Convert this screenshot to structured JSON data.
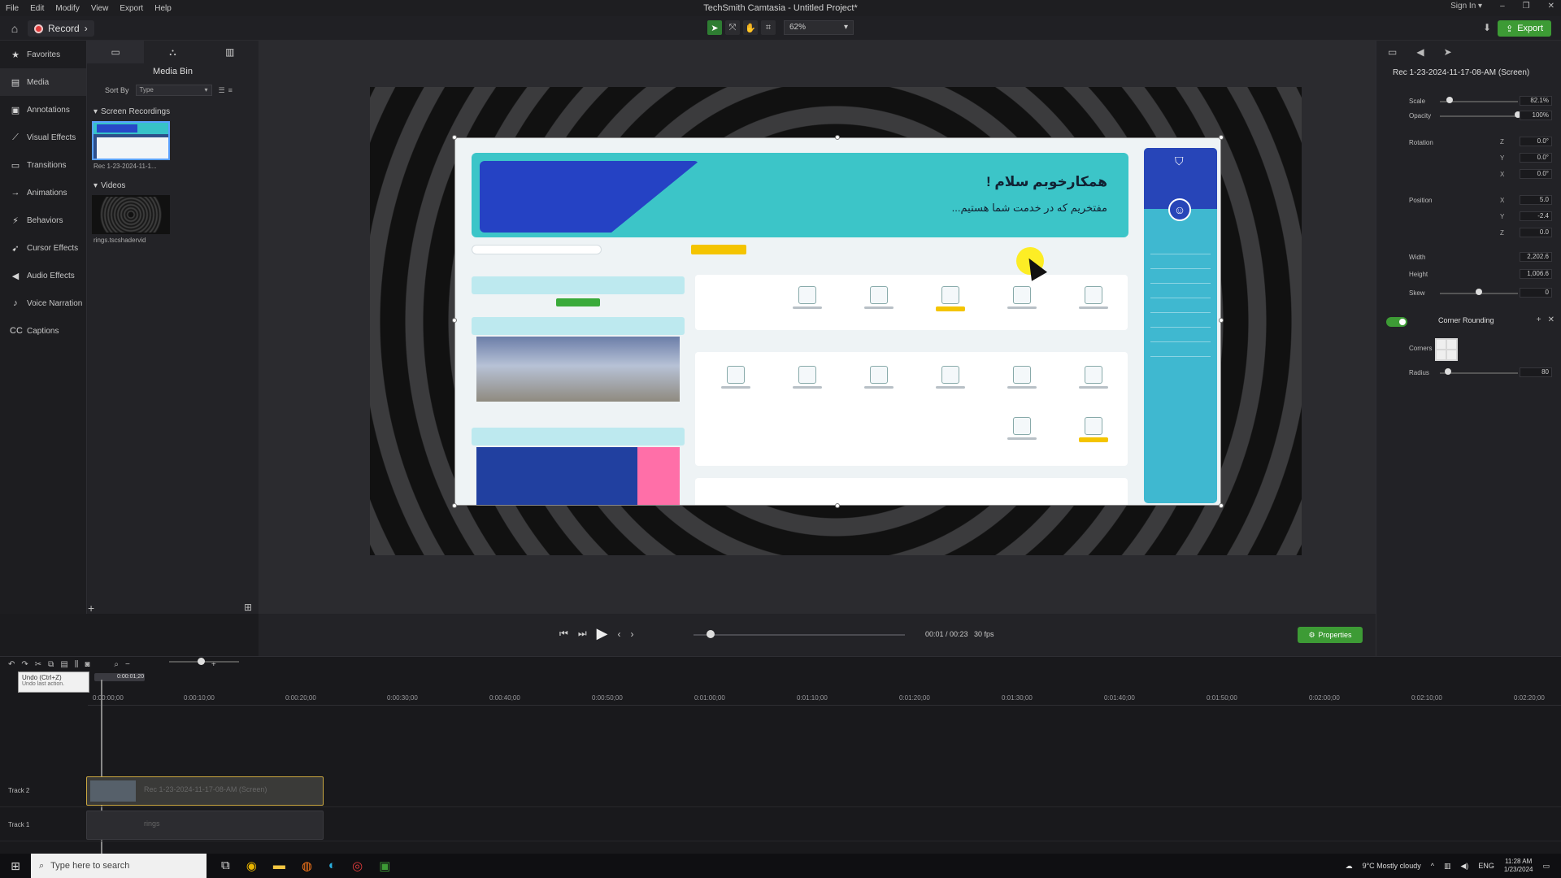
{
  "window": {
    "title": "TechSmith Camtasia - Untitled Project*",
    "menu": [
      "File",
      "Edit",
      "Modify",
      "View",
      "Export",
      "Help"
    ],
    "sign_in": "Sign In ▾"
  },
  "toolbar": {
    "record_label": "Record",
    "zoom_value": "62%",
    "export_label": "Export"
  },
  "sidebar": {
    "items": [
      {
        "label": "Favorites",
        "icon": "star-icon"
      },
      {
        "label": "Media",
        "icon": "film-icon"
      },
      {
        "label": "Annotations",
        "icon": "annotation-icon"
      },
      {
        "label": "Visual Effects",
        "icon": "wand-icon"
      },
      {
        "label": "Transitions",
        "icon": "transition-icon"
      },
      {
        "label": "Animations",
        "icon": "arrow-icon"
      },
      {
        "label": "Behaviors",
        "icon": "behavior-icon"
      },
      {
        "label": "Cursor Effects",
        "icon": "cursor-icon"
      },
      {
        "label": "Audio Effects",
        "icon": "speaker-icon"
      },
      {
        "label": "Voice Narration",
        "icon": "mic-icon"
      },
      {
        "label": "Captions",
        "icon": "cc-icon"
      }
    ]
  },
  "media_bin": {
    "title": "Media Bin",
    "sort_by_label": "Sort By",
    "sort_value": "Type",
    "section_recordings": "Screen Recordings",
    "recording_name": "Rec 1-23-2024-11-1...",
    "section_videos": "Videos",
    "video_name": "rings.tscshadervid"
  },
  "canvas": {
    "banner_title": "همکارخوبم سلام !",
    "banner_sub": "مفتخریم که در خدمت شما هستیم..."
  },
  "playback": {
    "time": "00:01 / 00:23",
    "fps": "30 fps",
    "properties_label": "Properties"
  },
  "properties": {
    "clip_name": "Rec 1-23-2024-11-17-08-AM (Screen)",
    "scale_label": "Scale",
    "scale_value": "82.1%",
    "scale_level": 0.12,
    "opacity_label": "Opacity",
    "opacity_value": "100%",
    "opacity_level": 1.0,
    "rotation_label": "Rotation",
    "rot_z": "0.0°",
    "rot_y": "0.0°",
    "rot_x": "0.0°",
    "position_label": "Position",
    "pos_x": "5.0",
    "pos_y": "-2.4",
    "pos_z": "0.0",
    "width_label": "Width",
    "width_value": "2,202.6",
    "height_label": "Height",
    "height_value": "1,006.6",
    "skew_label": "Skew",
    "skew_value": "0",
    "skew_level": 0.5,
    "corner_rounding_label": "Corner Rounding",
    "corners_label": "Corners",
    "radius_label": "Radius",
    "radius_value": "80",
    "radius_level": 0.1
  },
  "timeline": {
    "tooltip_title": "Undo (Ctrl+Z)",
    "tooltip_desc": "Undo last action.",
    "playhead_time": "0:00:01;20",
    "ticks": [
      "0:00:00;00",
      "0:00:10;00",
      "0:00:20;00",
      "0:00:30;00",
      "0:00:40;00",
      "0:00:50;00",
      "0:01:00;00",
      "0:01:10;00",
      "0:01:20;00",
      "0:01:30;00",
      "0:01:40;00",
      "0:01:50;00",
      "0:02:00;00",
      "0:02:10;00",
      "0:02:20;00"
    ],
    "track2_label": "Track 2",
    "track1_label": "Track 1",
    "clip_screen": "Rec 1-23-2024-11-17-08-AM (Screen)",
    "clip_rings": "rings"
  },
  "taskbar": {
    "search_placeholder": "Type here to search",
    "weather": "9°C  Mostly cloudy",
    "lang": "ENG",
    "time": "11:28 AM",
    "date": "1/23/2024"
  }
}
